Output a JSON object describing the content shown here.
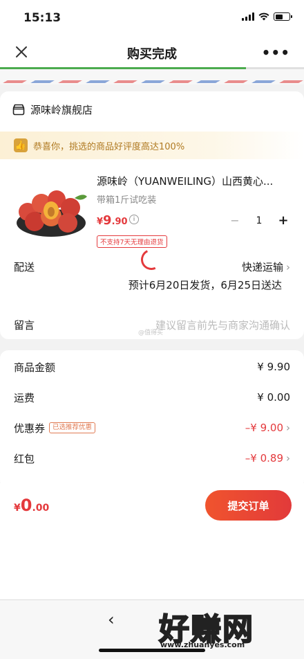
{
  "status": {
    "time": "15:13"
  },
  "nav": {
    "title": "购买完成",
    "more": "•••",
    "progress_fraction": 0.81
  },
  "store": {
    "name": "源味岭旗舰店"
  },
  "congrats": {
    "text": "恭喜你，挑选的商品好评度高达100%"
  },
  "product": {
    "title": "源味岭（YUANWEILING）山西黄心...",
    "spec": "带箱1斤试吃装",
    "price_symbol": "¥",
    "price_int": "9",
    "price_dec": ".90",
    "quantity": "1",
    "no_return": "不支持7天无理由退货"
  },
  "delivery": {
    "label": "配送",
    "value": "快递运输",
    "eta": "预计6月20日发货，6月25日送达"
  },
  "message": {
    "label": "留言",
    "placeholder": "建议留言前先与商家沟通确认",
    "watermark": "@值得买"
  },
  "fees": [
    {
      "label": "商品金额",
      "value": "¥ 9.90",
      "tag": "",
      "red": false,
      "chevron": false
    },
    {
      "label": "运费",
      "value": "¥ 0.00",
      "tag": "",
      "red": false,
      "chevron": false
    },
    {
      "label": "优惠券",
      "value": "–¥ 9.00",
      "tag": "已选推荐优惠",
      "red": true,
      "chevron": true
    },
    {
      "label": "红包",
      "value": "–¥ 0.89",
      "tag": "",
      "red": true,
      "chevron": true
    }
  ],
  "footer": {
    "total_symbol": "¥",
    "total_int": "0",
    "total_dec": ".00",
    "submit": "提交订单"
  },
  "brand": {
    "logo": "好赚网",
    "url": "www.zhuanyes.com"
  },
  "colors": {
    "accent": "#e4393c",
    "progress": "#4bab4e",
    "congrats_text": "#b07a22"
  }
}
